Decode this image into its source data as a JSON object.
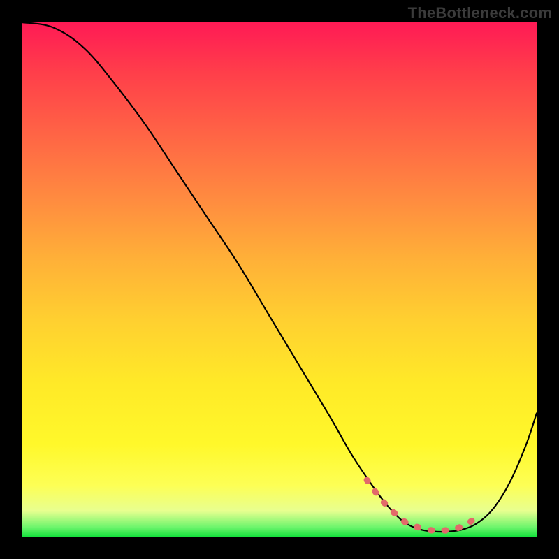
{
  "watermark": "TheBottleneck.com",
  "colors": {
    "curve_stroke": "#000000",
    "marker_fill": "#e26a6a",
    "background": "#000000"
  },
  "chart_data": {
    "type": "line",
    "title": "",
    "xlabel": "",
    "ylabel": "",
    "xlim": [
      0,
      100
    ],
    "ylim": [
      0,
      100
    ],
    "series": [
      {
        "name": "curve",
        "x": [
          0,
          6,
          12,
          18,
          24,
          30,
          36,
          42,
          48,
          54,
          60,
          64,
          68,
          71,
          74,
          77,
          80,
          83,
          86,
          89,
          92,
          95,
          98,
          100
        ],
        "y": [
          100,
          99,
          95,
          88,
          80,
          71,
          62,
          53,
          43,
          33,
          23,
          16,
          10,
          6,
          3,
          1.5,
          1,
          1,
          1.5,
          3,
          6,
          11,
          18,
          24
        ]
      }
    ],
    "markers": {
      "name": "optimal-range",
      "x": [
        67,
        70,
        73,
        75,
        77,
        79,
        81,
        83,
        85,
        87,
        89
      ],
      "y": [
        11,
        7,
        4,
        2.5,
        1.8,
        1.3,
        1.2,
        1.3,
        1.8,
        2.8,
        4.5
      ]
    }
  }
}
